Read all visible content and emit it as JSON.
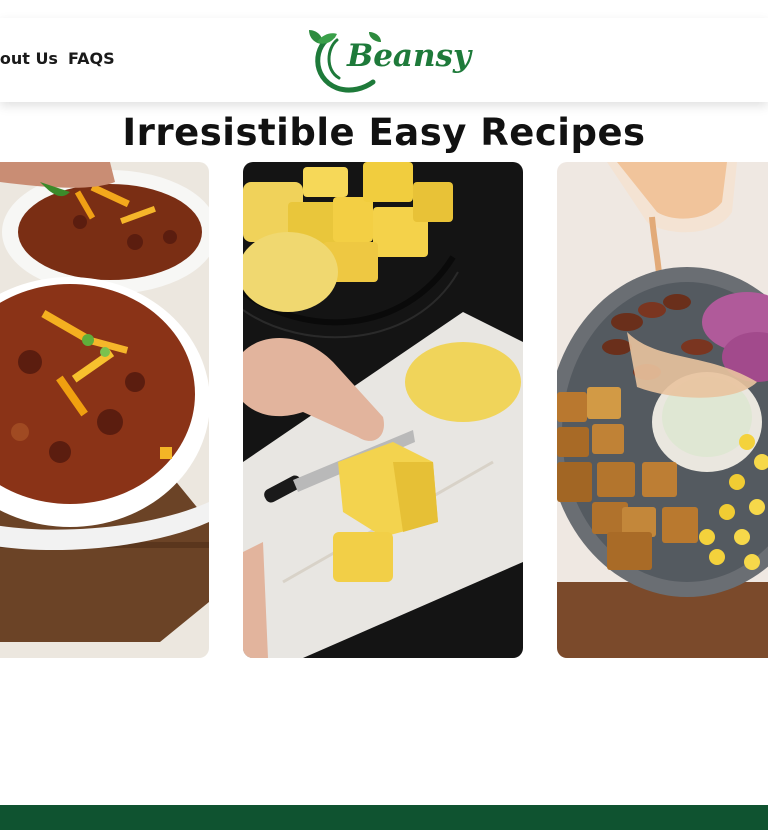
{
  "header": {
    "nav": [
      {
        "label": "About Us"
      },
      {
        "label": "FAQS"
      }
    ],
    "logo_text": "Beansy"
  },
  "section": {
    "title": "Irresistible Easy Recipes"
  },
  "recipe_cards": [
    {
      "image": "bowls of chili with kidney beans and shredded cheddar"
    },
    {
      "image": "hands cutting boiled potatoes into cubes on a cutting board"
    },
    {
      "image": "rice bowl with beans, tofu cubes, corn and red onion with creamy sauce"
    }
  ],
  "colors": {
    "brand_green": "#1e7a3a",
    "footer_green": "#0f5330",
    "text_dark": "#111111"
  }
}
